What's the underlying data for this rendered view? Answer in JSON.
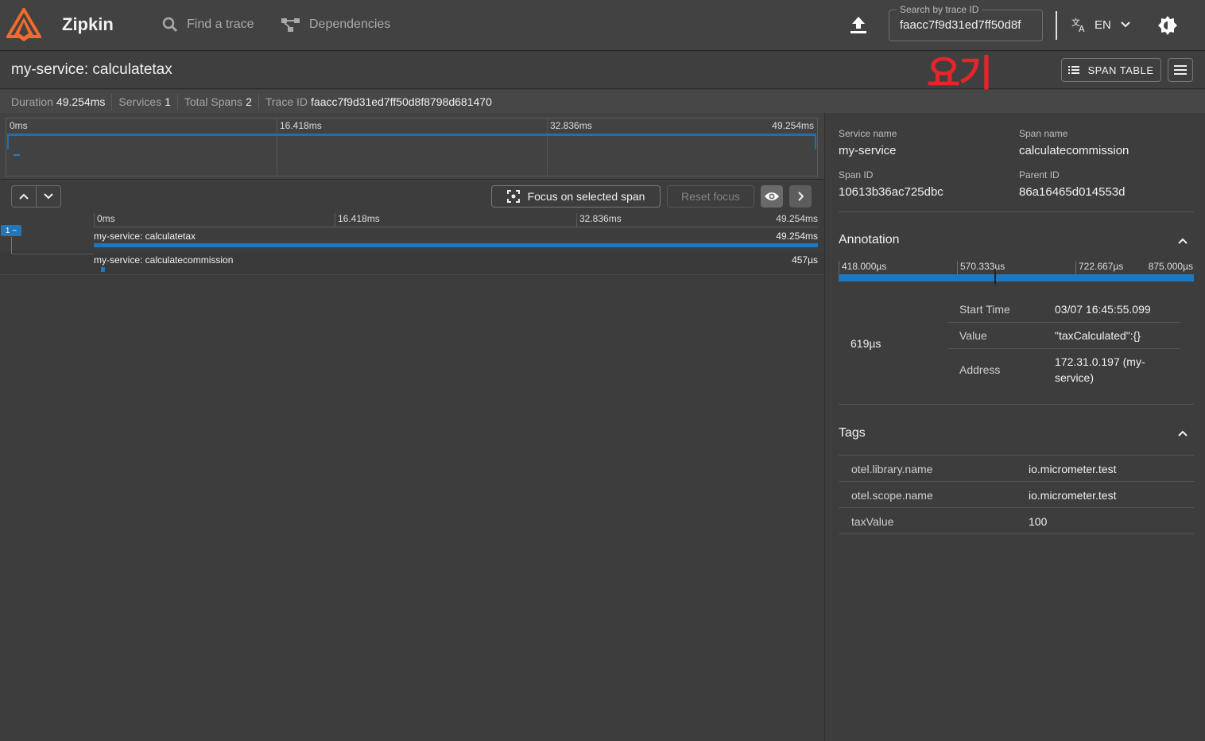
{
  "app": {
    "brand": "Zipkin"
  },
  "nav": {
    "find_trace": "Find a trace",
    "dependencies": "Dependencies"
  },
  "search": {
    "label": "Search by trace ID",
    "value": "faacc7f9d31ed7ff50d8f"
  },
  "lang": {
    "code": "EN"
  },
  "trace": {
    "title": "my-service: calculatetax",
    "overlay_text": "요기",
    "span_table_label": "SPAN TABLE"
  },
  "stats": {
    "duration_label": "Duration",
    "duration_value": "49.254ms",
    "services_label": "Services",
    "services_value": "1",
    "spans_label": "Total Spans",
    "spans_value": "2",
    "traceid_label": "Trace ID",
    "traceid_value": "faacc7f9d31ed7ff50d8f8798d681470"
  },
  "ticks": [
    "0ms",
    "16.418ms",
    "32.836ms",
    "49.254ms"
  ],
  "toolbar": {
    "focus_label": "Focus on selected span",
    "reset_label": "Reset focus"
  },
  "spans": [
    {
      "name": "my-service: calculatetax",
      "duration": "49.254ms",
      "toggle": "1 −"
    },
    {
      "name": "my-service: calculatecommission",
      "duration": "457µs"
    }
  ],
  "detail": {
    "service_name_label": "Service name",
    "service_name": "my-service",
    "span_name_label": "Span name",
    "span_name": "calculatecommission",
    "span_id_label": "Span ID",
    "span_id": "10613b36ac725dbc",
    "parent_id_label": "Parent ID",
    "parent_id": "86a16465d014553d"
  },
  "annotation": {
    "title": "Annotation",
    "ticks": [
      "418.000µs",
      "570.333µs",
      "722.667µs",
      "875.000µs"
    ],
    "duration": "619µs",
    "rows": [
      {
        "key": "Start Time",
        "value": "03/07 16:45:55.099"
      },
      {
        "key": "Value",
        "value": "\"taxCalculated\":{}"
      },
      {
        "key": "Address",
        "value": "172.31.0.197 (my-service)"
      }
    ]
  },
  "tags": {
    "title": "Tags",
    "rows": [
      {
        "key": "otel.library.name",
        "value": "io.micrometer.test"
      },
      {
        "key": "otel.scope.name",
        "value": "io.micrometer.test"
      },
      {
        "key": "taxValue",
        "value": "100"
      }
    ]
  },
  "colors": {
    "accent": "#1e78c0",
    "logo": "#f26b2b",
    "overlay": "#e8242b"
  }
}
